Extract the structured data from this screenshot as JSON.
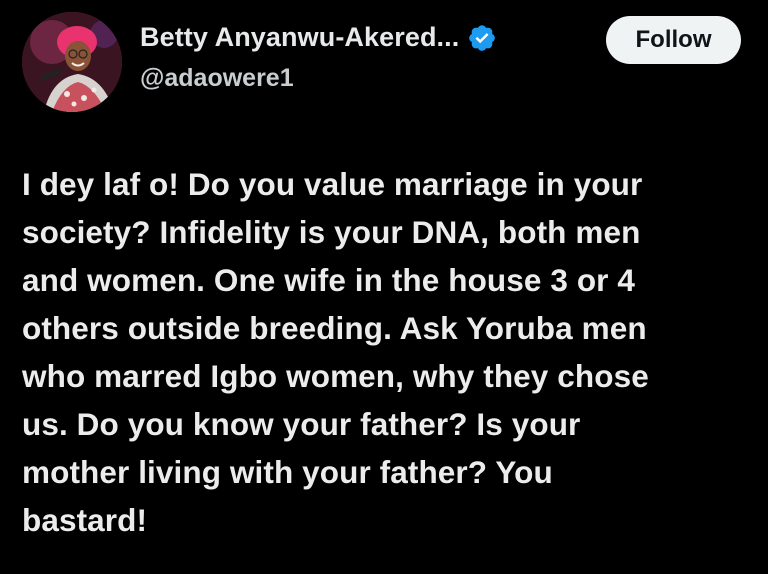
{
  "author": {
    "display_name": "Betty Anyanwu-Akered...",
    "handle": "@adaowere1",
    "verified": true
  },
  "follow_button": {
    "label": "Follow"
  },
  "tweet": {
    "lines": [
      "I dey laf o! Do you value marriage in your",
      "society? Infidelity is your DNA, both men",
      "and women. One wife in the house 3 or 4",
      "others outside breeding. Ask Yoruba men",
      "who marred Igbo women, why they chose",
      "us. Do you know your father? Is your",
      "mother living with your father? You",
      "bastard!"
    ]
  },
  "icons": {
    "verified": "verified-badge-icon",
    "avatar": "profile-avatar"
  },
  "colors": {
    "background": "#000000",
    "text": "#e7e9ea",
    "verified_blue": "#1d9bf0",
    "follow_bg": "#eff3f4",
    "follow_text": "#0f1419"
  }
}
